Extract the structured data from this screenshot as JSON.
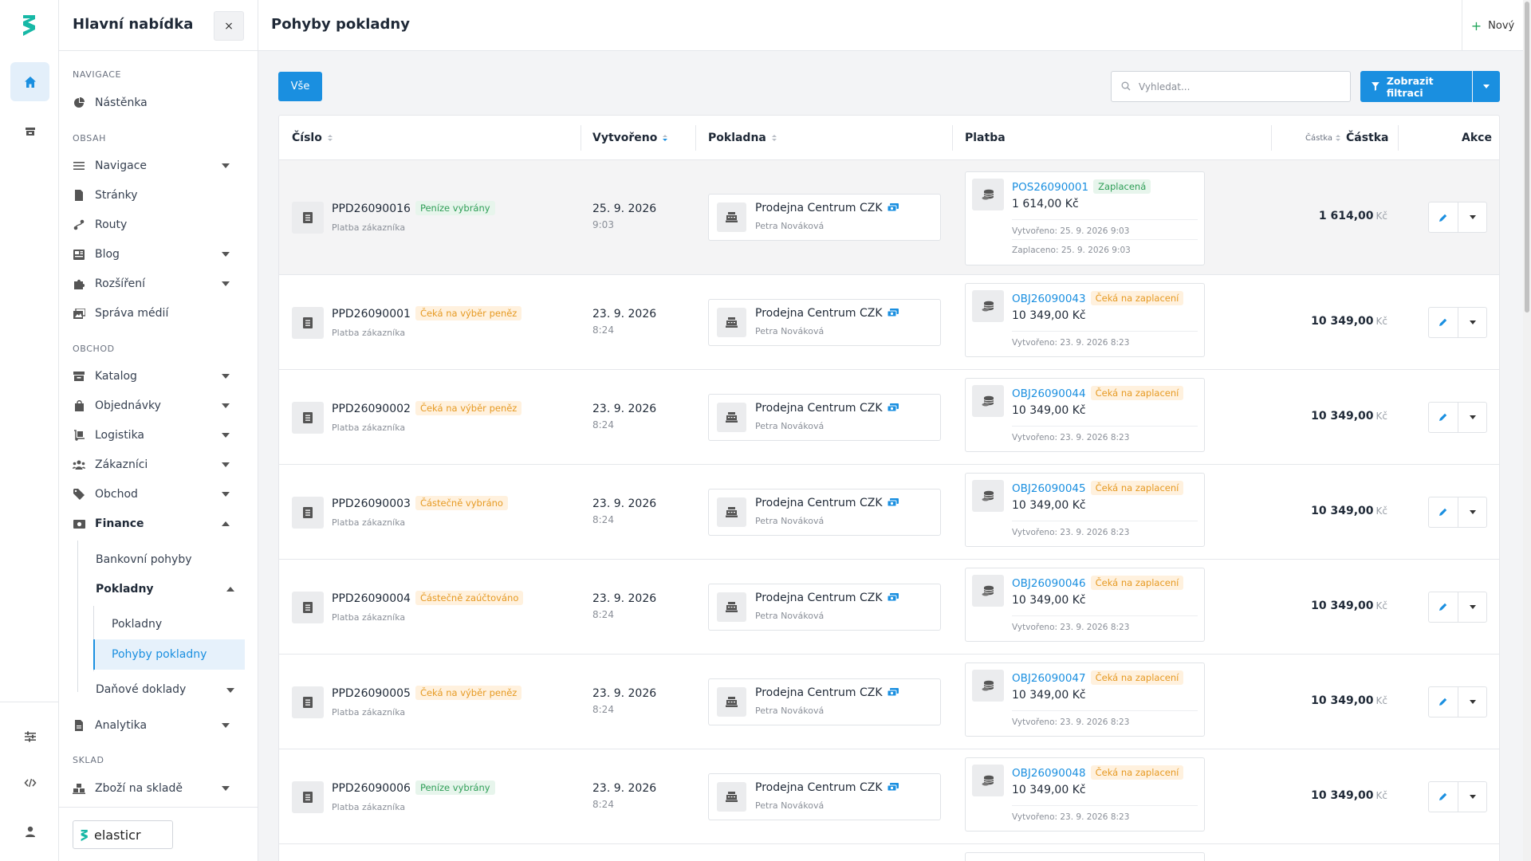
{
  "sidebar": {
    "title": "Hlavní nabídka",
    "close": "×",
    "sections": {
      "navigace": "NAVIGACE",
      "obsah": "OBSAH",
      "obchod": "OBCHOD",
      "sklad": "SKLAD"
    },
    "items": {
      "nastenka": "Nástěnka",
      "navigace": "Navigace",
      "stranky": "Stránky",
      "routy": "Routy",
      "blog": "Blog",
      "rozsireni": "Rozšíření",
      "sprava_medii": "Správa médií",
      "katalog": "Katalog",
      "objednavky": "Objednávky",
      "logistika": "Logistika",
      "zakaznici": "Zákazníci",
      "obchod": "Obchod",
      "finance": "Finance",
      "bankovni_pohyby": "Bankovní pohyby",
      "pokladny": "Pokladny",
      "pokladny_sub": "Pokladny",
      "pohyby_pokladny": "Pohyby pokladny",
      "danove_doklady": "Daňové doklady",
      "analytika": "Analytika",
      "zbozi_na_sklade": "Zboží na skladě"
    },
    "brand": "elasticr"
  },
  "header": {
    "title": "Pohyby pokladny",
    "new_label": "Nový"
  },
  "toolbar": {
    "all_label": "Vše",
    "search_placeholder": "Vyhledat...",
    "filter_label": "Zobrazit filtraci"
  },
  "table": {
    "columns": {
      "cislo": "Číslo",
      "vytvoreno": "Vytvořeno",
      "pokladna": "Pokladna",
      "platba": "Platba",
      "castka_small": "Částka",
      "castka": "Částka",
      "akce": "Akce"
    },
    "rows": [
      {
        "number": "PPD26090016",
        "status": "Peníze vybrány",
        "status_type": "green",
        "subtitle": "Platba zákazníka",
        "date": "25. 9. 2026",
        "time": "9:03",
        "register": "Prodejna Centrum CZK",
        "user": "Petra Nováková",
        "payment_id": "POS26090001",
        "payment_status": "Zaplacená",
        "payment_status_type": "green",
        "payment_amount": "1 614,00 Kč",
        "payment_created": "Vytvořeno: 25. 9. 2026 9:03",
        "payment_paid": "Zaplaceno: 25. 9. 2026 9:03",
        "amount": "1 614,00",
        "currency": "Kč"
      },
      {
        "number": "PPD26090001",
        "status": "Čeká na výběr peněz",
        "status_type": "orange",
        "subtitle": "Platba zákazníka",
        "date": "23. 9. 2026",
        "time": "8:24",
        "register": "Prodejna Centrum CZK",
        "user": "Petra Nováková",
        "payment_id": "OBJ26090043",
        "payment_status": "Čeká na zaplacení",
        "payment_status_type": "orange",
        "payment_amount": "10 349,00 Kč",
        "payment_created": "Vytvořeno: 23. 9. 2026 8:23",
        "amount": "10 349,00",
        "currency": "Kč"
      },
      {
        "number": "PPD26090002",
        "status": "Čeká na výběr peněz",
        "status_type": "orange",
        "subtitle": "Platba zákazníka",
        "date": "23. 9. 2026",
        "time": "8:24",
        "register": "Prodejna Centrum CZK",
        "user": "Petra Nováková",
        "payment_id": "OBJ26090044",
        "payment_status": "Čeká na zaplacení",
        "payment_status_type": "orange",
        "payment_amount": "10 349,00 Kč",
        "payment_created": "Vytvořeno: 23. 9. 2026 8:23",
        "amount": "10 349,00",
        "currency": "Kč"
      },
      {
        "number": "PPD26090003",
        "status": "Částečně vybráno",
        "status_type": "orange",
        "subtitle": "Platba zákazníka",
        "date": "23. 9. 2026",
        "time": "8:24",
        "register": "Prodejna Centrum CZK",
        "user": "Petra Nováková",
        "payment_id": "OBJ26090045",
        "payment_status": "Čeká na zaplacení",
        "payment_status_type": "orange",
        "payment_amount": "10 349,00 Kč",
        "payment_created": "Vytvořeno: 23. 9. 2026 8:23",
        "amount": "10 349,00",
        "currency": "Kč"
      },
      {
        "number": "PPD26090004",
        "status": "Částečně zaúčtováno",
        "status_type": "orange",
        "subtitle": "Platba zákazníka",
        "date": "23. 9. 2026",
        "time": "8:24",
        "register": "Prodejna Centrum CZK",
        "user": "Petra Nováková",
        "payment_id": "OBJ26090046",
        "payment_status": "Čeká na zaplacení",
        "payment_status_type": "orange",
        "payment_amount": "10 349,00 Kč",
        "payment_created": "Vytvořeno: 23. 9. 2026 8:23",
        "amount": "10 349,00",
        "currency": "Kč"
      },
      {
        "number": "PPD26090005",
        "status": "Čeká na výběr peněz",
        "status_type": "orange",
        "subtitle": "Platba zákazníka",
        "date": "23. 9. 2026",
        "time": "8:24",
        "register": "Prodejna Centrum CZK",
        "user": "Petra Nováková",
        "payment_id": "OBJ26090047",
        "payment_status": "Čeká na zaplacení",
        "payment_status_type": "orange",
        "payment_amount": "10 349,00 Kč",
        "payment_created": "Vytvořeno: 23. 9. 2026 8:23",
        "amount": "10 349,00",
        "currency": "Kč"
      },
      {
        "number": "PPD26090006",
        "status": "Peníze vybrány",
        "status_type": "green",
        "subtitle": "Platba zákazníka",
        "date": "23. 9. 2026",
        "time": "8:24",
        "register": "Prodejna Centrum CZK",
        "user": "Petra Nováková",
        "payment_id": "OBJ26090048",
        "payment_status": "Čeká na zaplacení",
        "payment_status_type": "orange",
        "payment_amount": "10 349,00 Kč",
        "payment_created": "Vytvořeno: 23. 9. 2026 8:23",
        "amount": "10 349,00",
        "currency": "Kč"
      }
    ]
  },
  "colors": {
    "accent": "#1a8fe0",
    "brand": "#17b8a6",
    "status_green": "#2f9e57",
    "status_orange": "#e69a23"
  }
}
